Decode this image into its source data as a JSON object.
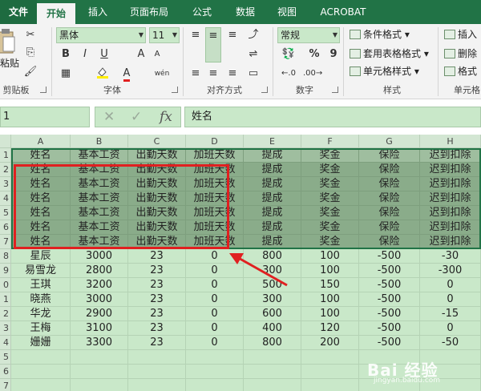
{
  "tabs": [
    {
      "label": "文件",
      "kind": "file"
    },
    {
      "label": "开始",
      "kind": "active"
    },
    {
      "label": "插入",
      "kind": "normal"
    },
    {
      "label": "页面布局",
      "kind": "normal"
    },
    {
      "label": "公式",
      "kind": "normal"
    },
    {
      "label": "数据",
      "kind": "normal"
    },
    {
      "label": "视图",
      "kind": "normal"
    },
    {
      "label": "ACROBAT",
      "kind": "normal"
    }
  ],
  "ribbon": {
    "clipboard": {
      "paste_label": "粘贴",
      "group_label": "剪贴板"
    },
    "font": {
      "name": "黑体",
      "size": "11",
      "bold": "B",
      "italic": "I",
      "underline": "U",
      "grow": "A",
      "shrink": "A",
      "font_color": "A",
      "wen": "wén",
      "group_label": "字体"
    },
    "alignment": {
      "group_label": "对齐方式"
    },
    "number": {
      "format": "常规",
      "percent": "%",
      "comma": "9",
      "group_label": "数字"
    },
    "styles": {
      "conditional": "条件格式",
      "table": "套用表格格式",
      "cell": "单元格样式",
      "group_label": "样式"
    },
    "cells": {
      "insert": "插入",
      "delete": "删除",
      "format": "格式",
      "group_label": "单元格"
    }
  },
  "formula_bar": {
    "name_box": "1",
    "cancel": "✕",
    "enter": "✓",
    "fx": "fx",
    "value": "姓名"
  },
  "columns": [
    "A",
    "B",
    "C",
    "D",
    "E",
    "F",
    "G",
    "H"
  ],
  "row_numbers": [
    "1",
    "2",
    "3",
    "4",
    "5",
    "6",
    "7",
    "8",
    "9",
    "0",
    "1",
    "2",
    "3",
    "4",
    "5",
    "6",
    "7"
  ],
  "rows": [
    [
      "姓名",
      "基本工资",
      "出勤天数",
      "加班天数",
      "提成",
      "奖金",
      "保险",
      "迟到扣除"
    ],
    [
      "姓名",
      "基本工资",
      "出勤天数",
      "加班天数",
      "提成",
      "奖金",
      "保险",
      "迟到扣除"
    ],
    [
      "姓名",
      "基本工资",
      "出勤天数",
      "加班天数",
      "提成",
      "奖金",
      "保险",
      "迟到扣除"
    ],
    [
      "姓名",
      "基本工资",
      "出勤天数",
      "加班天数",
      "提成",
      "奖金",
      "保险",
      "迟到扣除"
    ],
    [
      "姓名",
      "基本工资",
      "出勤天数",
      "加班天数",
      "提成",
      "奖金",
      "保险",
      "迟到扣除"
    ],
    [
      "姓名",
      "基本工资",
      "出勤天数",
      "加班天数",
      "提成",
      "奖金",
      "保险",
      "迟到扣除"
    ],
    [
      "姓名",
      "基本工资",
      "出勤天数",
      "加班天数",
      "提成",
      "奖金",
      "保险",
      "迟到扣除"
    ],
    [
      "星辰",
      "3000",
      "23",
      "0",
      "800",
      "100",
      "-500",
      "-30"
    ],
    [
      "易雪龙",
      "2800",
      "23",
      "0",
      "300",
      "100",
      "-500",
      "-300"
    ],
    [
      "王琪",
      "3200",
      "23",
      "0",
      "500",
      "150",
      "-500",
      "0"
    ],
    [
      "晓燕",
      "3000",
      "23",
      "0",
      "300",
      "100",
      "-500",
      "0"
    ],
    [
      "华龙",
      "2900",
      "23",
      "0",
      "600",
      "100",
      "-500",
      "-15"
    ],
    [
      "王梅",
      "3100",
      "23",
      "0",
      "400",
      "120",
      "-500",
      "0"
    ],
    [
      "姗姗",
      "3300",
      "23",
      "0",
      "800",
      "200",
      "-500",
      "-50"
    ],
    [
      "",
      "",
      "",
      "",
      "",
      "",
      "",
      ""
    ],
    [
      "",
      "",
      "",
      "",
      "",
      "",
      "",
      ""
    ],
    [
      "",
      "",
      "",
      "",
      "",
      "",
      "",
      ""
    ]
  ],
  "watermark": {
    "main": "Bai 经验",
    "sub": "jingyan.baidu.com"
  },
  "colors": {
    "brand": "#217346",
    "annotation": "#e02020"
  }
}
